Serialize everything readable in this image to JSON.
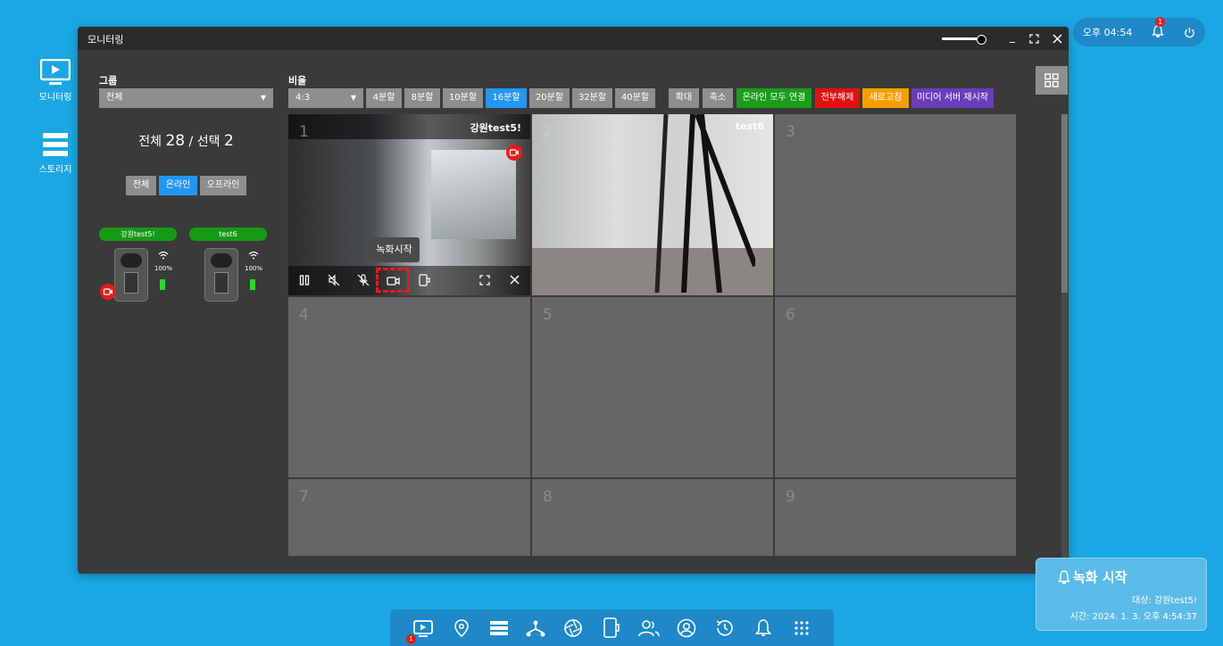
{
  "desktop": {
    "monitoring_label": "모니터링",
    "storage_label": "스토리지"
  },
  "tray": {
    "time": "오후 04:54",
    "notif_count": "1"
  },
  "window": {
    "title": "모니터링",
    "group_label": "그룹",
    "group_value": "전체",
    "ratio_label": "비율",
    "ratio_value": "4:3",
    "count_prefix": "전체",
    "count_total": "28",
    "count_sep": "/ 선택",
    "count_selected": "2",
    "filters": [
      "전체",
      "온라인",
      "오프라인"
    ],
    "split_buttons": [
      "4분할",
      "8분할",
      "10분할",
      "16분할",
      "20분할",
      "32분할",
      "40분할"
    ],
    "zoom_in": "확대",
    "zoom_out": "축소",
    "connect_all": "온라인 모두 연결",
    "disconnect_all": "전부해제",
    "refresh": "새로고침",
    "restart_media": "미디어 서버 재시작"
  },
  "devices": [
    {
      "name": "강원test5!",
      "battery": "100%"
    },
    {
      "name": "test6",
      "battery": "100%"
    }
  ],
  "cells": [
    {
      "num": "1",
      "name": "강원test5!"
    },
    {
      "num": "2",
      "name": "test6"
    },
    {
      "num": "3"
    },
    {
      "num": "4"
    },
    {
      "num": "5"
    },
    {
      "num": "6"
    },
    {
      "num": "7"
    },
    {
      "num": "8"
    },
    {
      "num": "9"
    }
  ],
  "tooltip": "녹화시작",
  "toast": {
    "title": "녹화 시작",
    "target": "대상: 강원test5!",
    "time": "시간: 2024. 1. 3. 오후 4:54:37"
  },
  "taskbar": {
    "badge": "1"
  },
  "colors": {
    "desktop": "#1aa7e3",
    "active_blue": "#2196f3",
    "connect_green": "#1a9e1a",
    "disconnect_red": "#e01010",
    "refresh_orange": "#f5a000",
    "restart_purple": "#6a3dbd",
    "device_green": "#159a15",
    "record_red": "#e81b1b"
  }
}
